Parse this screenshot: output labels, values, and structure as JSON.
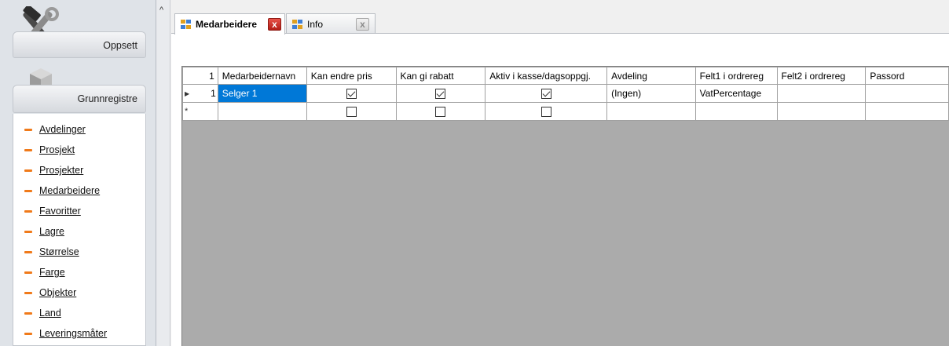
{
  "sidebar": {
    "groups": [
      {
        "label": "Oppsett",
        "icon": "tools-icon"
      },
      {
        "label": "Grunnregistre",
        "icon": "cubes-icon"
      }
    ],
    "items": [
      {
        "label": "Avdelinger"
      },
      {
        "label": "Prosjekt"
      },
      {
        "label": "Prosjekter"
      },
      {
        "label": "Medarbeidere"
      },
      {
        "label": "Favoritter"
      },
      {
        "label": "Lagre"
      },
      {
        "label": "Størrelse"
      },
      {
        "label": "Farge"
      },
      {
        "label": "Objekter"
      },
      {
        "label": "Land"
      },
      {
        "label": "Leveringsmåter"
      }
    ],
    "collapse_glyph": "^"
  },
  "tabs": [
    {
      "label": "Medarbeidere",
      "active": true,
      "close_glyph": "x"
    },
    {
      "label": "Info",
      "active": false,
      "close_glyph": "x"
    }
  ],
  "grid": {
    "row_header_label": "1",
    "columns": [
      "Medarbeidernavn",
      "Kan endre pris",
      "Kan gi rabatt",
      "Aktiv i kasse/dagsoppgj.",
      "Avdeling",
      "Felt1 i ordrereg",
      "Felt2 i ordrereg",
      "Passord"
    ],
    "rows": [
      {
        "number": "1",
        "current": true,
        "medarbeidernavn": "Selger 1",
        "kan_endre_pris": true,
        "kan_gi_rabatt": true,
        "aktiv_i_kasse": true,
        "avdeling": "(Ingen)",
        "felt1": "VatPercentage",
        "felt2": "",
        "passord": ""
      }
    ],
    "new_row_marker": "*"
  },
  "colors": {
    "accent_selection": "#0078d7",
    "nav_dash": "#f07a1a",
    "grid_background": "#ababab",
    "close_active": "#c6271f"
  }
}
